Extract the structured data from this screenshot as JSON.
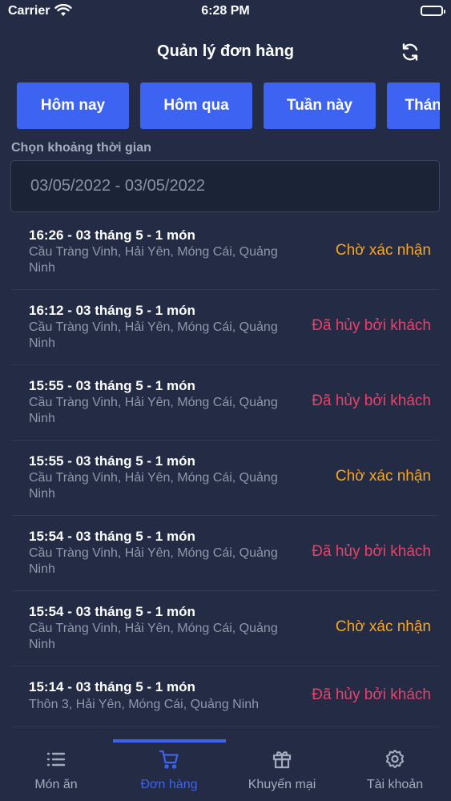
{
  "status_bar": {
    "carrier": "Carrier",
    "time": "6:28 PM"
  },
  "header": {
    "title": "Quản lý đơn hàng",
    "refresh_icon": "refresh-icon"
  },
  "filters": [
    "Hôm nay",
    "Hôm qua",
    "Tuần này",
    "Tháng này"
  ],
  "date_range": {
    "label": "Chọn khoảng thời gian",
    "value": "03/05/2022 - 03/05/2022"
  },
  "colors": {
    "accent": "#3d63f3",
    "pending": "#f5a623",
    "cancelled": "#ee3f6a",
    "background": "#232c44"
  },
  "orders": [
    {
      "title": "16:26 - 03 tháng 5 - 1 món",
      "address": "Cầu Tràng Vinh, Hải Yên, Móng Cái, Quảng Ninh",
      "status": "Chờ xác nhận",
      "status_type": "pending"
    },
    {
      "title": "16:12 - 03 tháng 5 - 1 món",
      "address": "Cầu Tràng Vinh, Hải Yên, Móng Cái, Quảng Ninh",
      "status": "Đã hủy bởi khách",
      "status_type": "cancelled"
    },
    {
      "title": "15:55 - 03 tháng 5 - 1 món",
      "address": "Cầu Tràng Vinh, Hải Yên, Móng Cái, Quảng Ninh",
      "status": "Đã hủy bởi khách",
      "status_type": "cancelled"
    },
    {
      "title": "15:55 - 03 tháng 5 - 1 món",
      "address": "Cầu Tràng Vinh, Hải Yên, Móng Cái, Quảng Ninh",
      "status": "Chờ xác nhận",
      "status_type": "pending"
    },
    {
      "title": "15:54 - 03 tháng 5 - 1 món",
      "address": "Cầu Tràng Vinh, Hải Yên, Móng Cái, Quảng Ninh",
      "status": "Đã hủy bởi khách",
      "status_type": "cancelled"
    },
    {
      "title": "15:54 - 03 tháng 5 - 1 món",
      "address": "Cầu Tràng Vinh, Hải Yên, Móng Cái, Quảng Ninh",
      "status": "Chờ xác nhận",
      "status_type": "pending"
    },
    {
      "title": "15:14 - 03 tháng 5 - 1 món",
      "address": "Thôn 3, Hải Yên, Móng Cái, Quảng Ninh",
      "status": "Đã hủy bởi khách",
      "status_type": "cancelled"
    }
  ],
  "tabs": [
    {
      "label": "Món ăn",
      "icon": "list-icon",
      "active": false
    },
    {
      "label": "Đơn hàng",
      "icon": "cart-icon",
      "active": true
    },
    {
      "label": "Khuyến mại",
      "icon": "gift-icon",
      "active": false
    },
    {
      "label": "Tài khoản",
      "icon": "gear-icon",
      "active": false
    }
  ]
}
